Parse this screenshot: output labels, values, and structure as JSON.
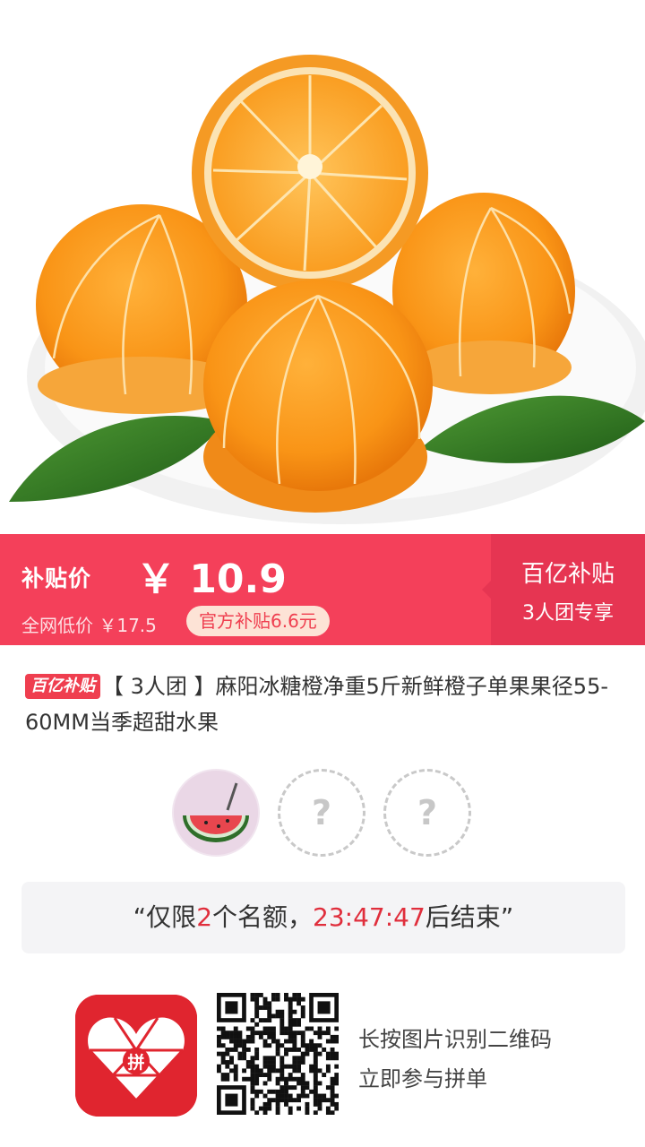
{
  "price_bar": {
    "subsidy_label": "补贴价",
    "price": "￥ 10.9",
    "net_low": "全网低价 ￥17.5",
    "official_badge": "官方补贴6.6元",
    "billion_subsidy": "百亿补贴",
    "group_exclusive": "3人团专享"
  },
  "product": {
    "tag": "百亿补贴",
    "title": "【 3人团 】麻阳冰糖橙净重5斤新鲜橙子单果果径55-60MM当季超甜水果"
  },
  "group": {
    "empty_slot_symbol": "?"
  },
  "countdown": {
    "prefix": "“仅限",
    "quota": "2",
    "middle": "个名额，",
    "time": "23:47:47",
    "suffix": "后结束”"
  },
  "footer": {
    "app_icon": "pinduoduo-logo-icon",
    "app_logo_char": "拼",
    "scan_line1": "长按图片识别二维码",
    "scan_line2": "立即参与拼单"
  },
  "colors": {
    "accent": "#f4405a",
    "accent_dark": "#e63552",
    "countdown_red": "#e02e3c",
    "brand_red": "#e0252f"
  }
}
